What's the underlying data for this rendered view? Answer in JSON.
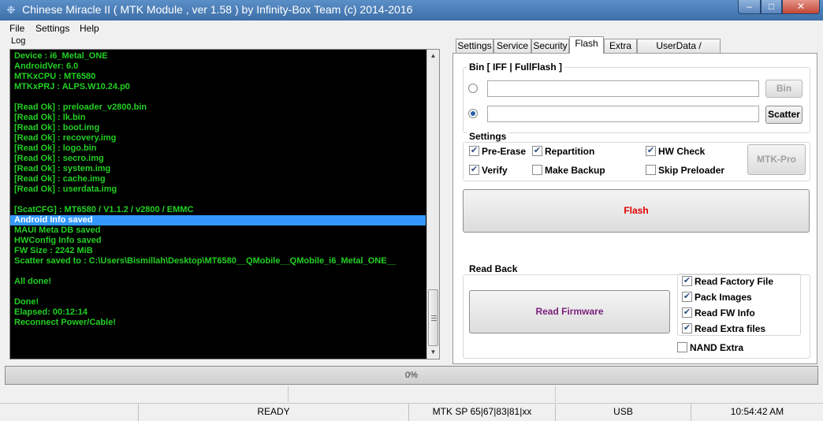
{
  "window": {
    "title": "Chinese Miracle II ( MTK Module , ver 1.58 ) by Infinity-Box Team (c) 2014-2016",
    "min_glyph": "‒",
    "max_glyph": "□",
    "close_glyph": "✕"
  },
  "menu": {
    "items": [
      "File",
      "Settings",
      "Help"
    ]
  },
  "log": {
    "label": "Log",
    "lines": [
      "Device   : i6_Metal_ONE",
      "AndroidVer: 6.0",
      "MTKxCPU  : MT6580",
      "MTKxPRJ  : ALPS.W10.24.p0",
      "",
      "[Read Ok] : preloader_v2800.bin",
      "[Read Ok] : lk.bin",
      "[Read Ok] : boot.img",
      "[Read Ok] : recovery.img",
      "[Read Ok] : logo.bin",
      "[Read Ok] : secro.img",
      "[Read Ok] : system.img",
      "[Read Ok] : cache.img",
      "[Read Ok] : userdata.img",
      "",
      "[ScatCFG] : MT6580 / V1.1.2 / v2800 / EMMC",
      "Android Info saved",
      "MAUI Meta DB saved",
      "HWConfig Info saved",
      "FW Size : 2242 MiB",
      "Scatter saved to : C:\\Users\\Bismillah\\Desktop\\MT6580__QMobile__QMobile_i6_Metal_ONE__",
      "",
      "All done!",
      "",
      "Done!",
      "Elapsed: 00:12:14",
      "Reconnect Power/Cable!"
    ],
    "selected_index": 16
  },
  "tabs": [
    "Settings",
    "Service",
    "Security",
    "Flash",
    "Extra",
    "UserData / Forensic"
  ],
  "active_tab": "Flash",
  "bin": {
    "label": "Bin  [ IFF | FullFlash ]",
    "bin_field": "",
    "scatter_field": "",
    "bin_button": "Bin",
    "scatter_button": "Scatter"
  },
  "settings": {
    "label": "Settings",
    "pre_erase": "Pre-Erase",
    "repartition": "Repartition",
    "hw_check": "HW Check",
    "verify": "Verify",
    "make_backup": "Make Backup",
    "skip_preloader": "Skip Preloader",
    "mtk_pro": "MTK-Pro"
  },
  "flash_button": "Flash",
  "readback": {
    "label": "Read Back",
    "read_firmware": "Read Firmware",
    "read_factory_file": "Read Factory File",
    "pack_images": "Pack Images",
    "read_fw_info": "Read FW Info",
    "read_extra_files": "Read Extra files",
    "nand_extra": "NAND Extra"
  },
  "check_glyph": "✔",
  "progress": {
    "text": "0%",
    "value": 0
  },
  "status": {
    "state": "READY",
    "chip": "MTK SP 65|67|83|81|xx",
    "port": "USB",
    "time": "10:54:42 AM"
  },
  "colors": {
    "log_text": "#22d022",
    "log_bg": "#000000",
    "log_selection": "#3399ff",
    "flash_label": "#e00000",
    "read_firmware_label": "#7a1f7a"
  }
}
